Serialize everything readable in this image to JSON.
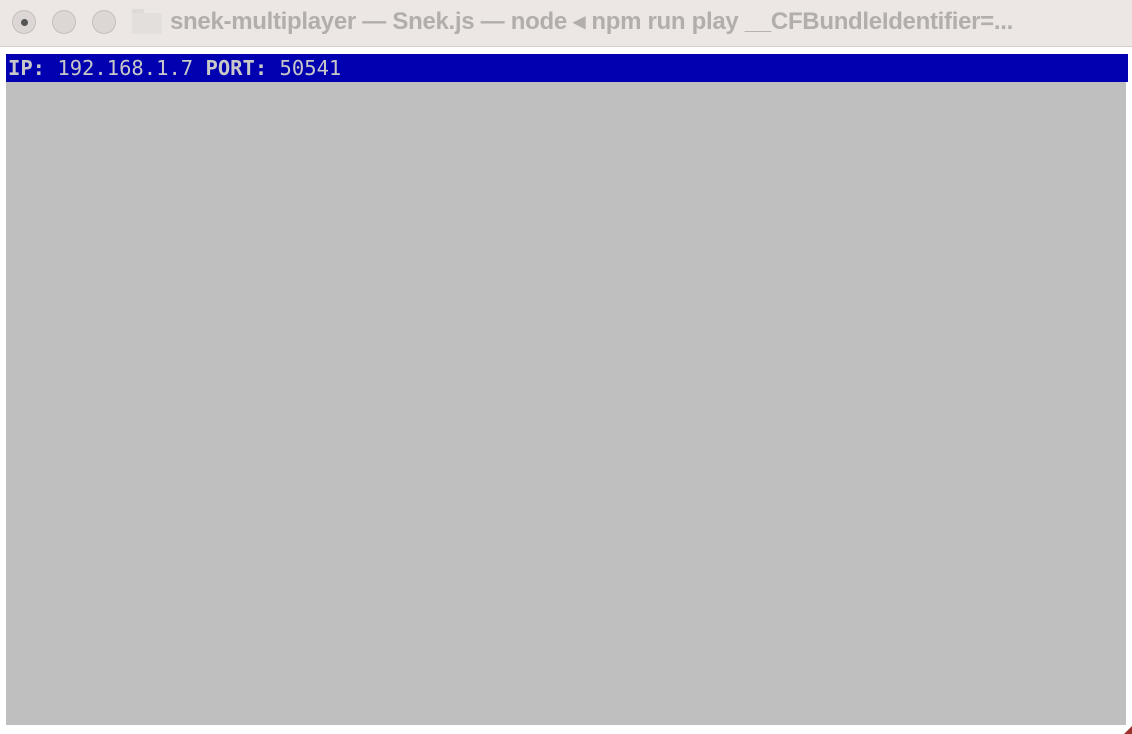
{
  "window": {
    "title": "snek-multiplayer — Snek.js — node ◂ npm run play __CFBundleIdentifier=...",
    "buttons": [
      "close",
      "minimize",
      "zoom"
    ],
    "folder_icon": "folder-icon"
  },
  "terminal": {
    "background": "#bfbfbf",
    "status_bar": {
      "background": "#0000b0",
      "ip_label": "IP:",
      "ip_value": "192.168.1.7",
      "port_label": "PORT:",
      "port_value": "50541"
    }
  }
}
